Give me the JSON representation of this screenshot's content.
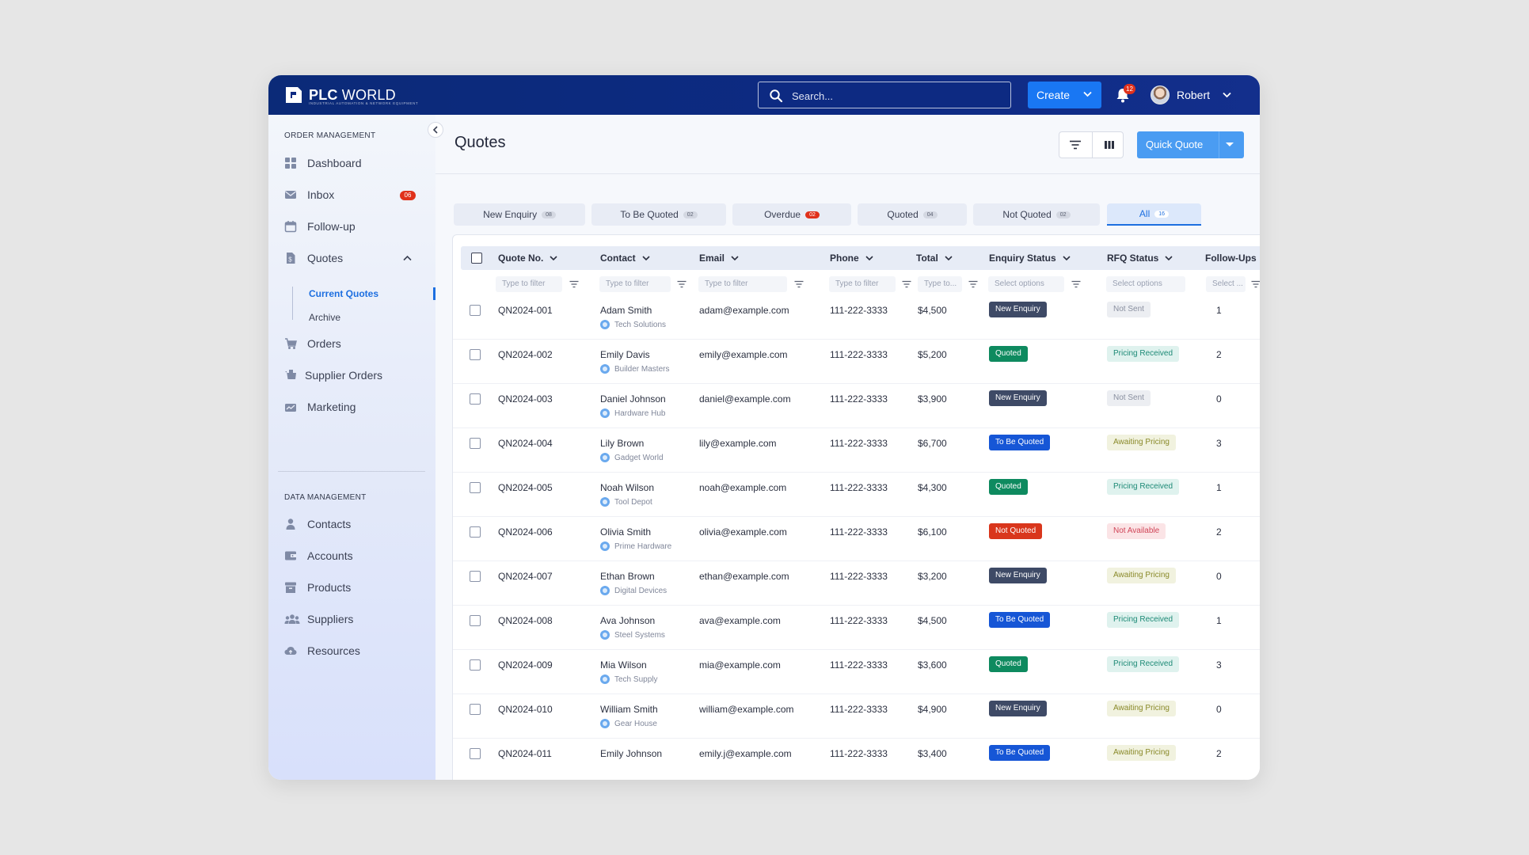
{
  "app": {
    "logo_bold": "PLC",
    "logo_light": " WORLD",
    "logo_tagline": "INDUSTRIAL AUTOMATION & NETWORK EQUIPMENT"
  },
  "header": {
    "search_placeholder": "Search...",
    "create_label": "Create",
    "notification_count": "12",
    "user_name": "Robert"
  },
  "sidebar": {
    "section1": "ORDER MANAGEMENT",
    "items": [
      {
        "label": "Dashboard",
        "icon": "dashboard-icon"
      },
      {
        "label": "Inbox",
        "icon": "mail-icon",
        "badge": "06"
      },
      {
        "label": "Follow-up",
        "icon": "calendar-icon"
      },
      {
        "label": "Quotes",
        "icon": "quotes-icon"
      },
      {
        "label": "Orders",
        "icon": "cart-icon"
      },
      {
        "label": "Supplier Orders",
        "icon": "supplier-cart-icon"
      },
      {
        "label": "Marketing",
        "icon": "marketing-icon"
      }
    ],
    "quotes_sub": [
      {
        "label": "Current Quotes"
      },
      {
        "label": "Archive"
      }
    ],
    "section2": "DATA MANAGEMENT",
    "items2": [
      {
        "label": "Contacts",
        "icon": "person-icon"
      },
      {
        "label": "Accounts",
        "icon": "wallet-icon"
      },
      {
        "label": "Products",
        "icon": "box-icon"
      },
      {
        "label": "Suppliers",
        "icon": "group-icon"
      },
      {
        "label": "Resources",
        "icon": "cloud-icon"
      }
    ]
  },
  "main": {
    "title": "Quotes",
    "quick_quote_label": "Quick Quote",
    "tabs": [
      {
        "label": "New Enquiry",
        "count": "08"
      },
      {
        "label": "To Be Quoted",
        "count": "02"
      },
      {
        "label": "Overdue",
        "count": "02"
      },
      {
        "label": "Quoted",
        "count": "04"
      },
      {
        "label": "Not Quoted",
        "count": "02"
      },
      {
        "label": "All",
        "count": "16"
      }
    ],
    "columns": [
      "Quote No.",
      "Contact",
      "Email",
      "Phone",
      "Total",
      "Enquiry Status",
      "RFQ Status",
      "Follow-Ups"
    ],
    "filters": [
      "Type to filter",
      "Type to filter",
      "Type to filter",
      "Type to filter",
      "Type to...",
      "Select options",
      "Select options",
      "Select ..."
    ],
    "rows": [
      {
        "quote": "QN2024-001",
        "contact": "Adam Smith",
        "company": "Tech Solutions",
        "email": "adam@example.com",
        "phone": "111-222-3333",
        "total": "$4,500",
        "enquiry": "New Enquiry",
        "rfq": "Not Sent",
        "followups": "1"
      },
      {
        "quote": "QN2024-002",
        "contact": "Emily Davis",
        "company": "Builder Masters",
        "email": "emily@example.com",
        "phone": "111-222-3333",
        "total": "$5,200",
        "enquiry": "Quoted",
        "rfq": "Pricing Received",
        "followups": "2"
      },
      {
        "quote": "QN2024-003",
        "contact": "Daniel Johnson",
        "company": "Hardware Hub",
        "email": "daniel@example.com",
        "phone": "111-222-3333",
        "total": "$3,900",
        "enquiry": "New Enquiry",
        "rfq": "Not Sent",
        "followups": "0"
      },
      {
        "quote": "QN2024-004",
        "contact": "Lily Brown",
        "company": "Gadget World",
        "email": "lily@example.com",
        "phone": "111-222-3333",
        "total": "$6,700",
        "enquiry": "To Be Quoted",
        "rfq": "Awaiting Pricing",
        "followups": "3"
      },
      {
        "quote": "QN2024-005",
        "contact": "Noah Wilson",
        "company": "Tool Depot",
        "email": "noah@example.com",
        "phone": "111-222-3333",
        "total": "$4,300",
        "enquiry": "Quoted",
        "rfq": "Pricing Received",
        "followups": "1"
      },
      {
        "quote": "QN2024-006",
        "contact": "Olivia Smith",
        "company": "Prime Hardware",
        "email": "olivia@example.com",
        "phone": "111-222-3333",
        "total": "$6,100",
        "enquiry": "Not Quoted",
        "rfq": "Not Available",
        "followups": "2"
      },
      {
        "quote": "QN2024-007",
        "contact": "Ethan Brown",
        "company": "Digital Devices",
        "email": "ethan@example.com",
        "phone": "111-222-3333",
        "total": "$3,200",
        "enquiry": "New Enquiry",
        "rfq": "Awaiting Pricing",
        "followups": "0"
      },
      {
        "quote": "QN2024-008",
        "contact": "Ava Johnson",
        "company": "Steel Systems",
        "email": "ava@example.com",
        "phone": "111-222-3333",
        "total": "$4,500",
        "enquiry": "To Be Quoted",
        "rfq": "Pricing Received",
        "followups": "1"
      },
      {
        "quote": "QN2024-009",
        "contact": "Mia Wilson",
        "company": "Tech Supply",
        "email": "mia@example.com",
        "phone": "111-222-3333",
        "total": "$3,600",
        "enquiry": "Quoted",
        "rfq": "Pricing Received",
        "followups": "3"
      },
      {
        "quote": "QN2024-010",
        "contact": "William Smith",
        "company": "Gear House",
        "email": "william@example.com",
        "phone": "111-222-3333",
        "total": "$4,900",
        "enquiry": "New Enquiry",
        "rfq": "Awaiting Pricing",
        "followups": "0"
      },
      {
        "quote": "QN2024-011",
        "contact": "Emily Johnson",
        "company": "",
        "email": "emily.j@example.com",
        "phone": "111-222-3333",
        "total": "$3,400",
        "enquiry": "To Be Quoted",
        "rfq": "Awaiting Pricing",
        "followups": "2"
      }
    ]
  },
  "colors": {
    "brand_navy": "#0d2a82",
    "primary_blue": "#1977f3",
    "badge_red": "#e0311b",
    "status_new_enquiry": "#3e4a66",
    "status_quoted": "#0e8a5f",
    "status_to_be_quoted": "#1656d6",
    "status_not_quoted": "#d9361c",
    "rfq_not_sent_bg": "#eceef2",
    "rfq_not_sent_fg": "#8a90a0",
    "rfq_received_bg": "#dff2ee",
    "rfq_received_fg": "#1d8a76",
    "rfq_awaiting_bg": "#f1f2df",
    "rfq_awaiting_fg": "#8a8a2a",
    "rfq_not_available_bg": "#fbe4e6",
    "rfq_not_available_fg": "#d04558"
  }
}
